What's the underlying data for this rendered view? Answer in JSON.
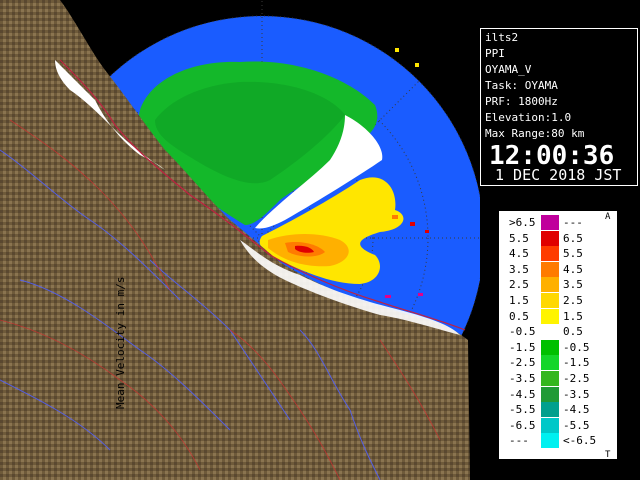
{
  "info": {
    "site": "ilts2",
    "mode": "PPI",
    "product": "OYAMA_V",
    "task": "Task: OYAMA",
    "prf": "PRF: 1800Hz",
    "elevation": "Elevation:1.0",
    "max_range": "Max Range:80 km",
    "time": "12:00:36",
    "date": "1 DEC 2018 JST"
  },
  "legend": {
    "title": "Mean Velocity in m/s",
    "top_mark": "A",
    "bottom_mark": "T",
    "rows": [
      {
        "left": ">6.5",
        "right": "---",
        "color": "#c0009c"
      },
      {
        "left": "5.5",
        "right": "6.5",
        "color": "#e00000"
      },
      {
        "left": "4.5",
        "right": "5.5",
        "color": "#ff3b00"
      },
      {
        "left": "3.5",
        "right": "4.5",
        "color": "#ff7b00"
      },
      {
        "left": "2.5",
        "right": "3.5",
        "color": "#ffb000"
      },
      {
        "left": "1.5",
        "right": "2.5",
        "color": "#ffd800"
      },
      {
        "left": "0.5",
        "right": "1.5",
        "color": "#fff400"
      },
      {
        "left": "-0.5",
        "right": "0.5",
        "color": "#ffffff"
      },
      {
        "left": "-1.5",
        "right": "-0.5",
        "color": "#00c000"
      },
      {
        "left": "-2.5",
        "right": "-1.5",
        "color": "#14d62a"
      },
      {
        "left": "-3.5",
        "right": "-2.5",
        "color": "#34b61e"
      },
      {
        "left": "-4.5",
        "right": "-3.5",
        "color": "#209a35"
      },
      {
        "left": "-5.5",
        "right": "-4.5",
        "color": "#00a08e"
      },
      {
        "left": "-6.5",
        "right": "-5.5",
        "color": "#00c8c8"
      },
      {
        "left": "---",
        "right": "<-6.5",
        "color": "#00f0f0"
      }
    ]
  },
  "colors": {
    "radar_background": "#1a5cff",
    "terrain": "#6e5a3a",
    "sea": "#1a5cff"
  }
}
